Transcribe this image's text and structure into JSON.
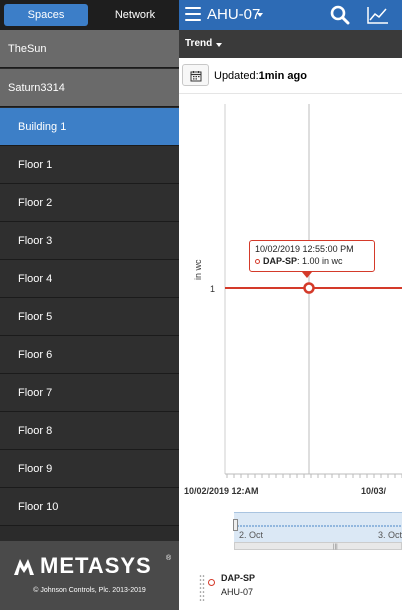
{
  "tabs": {
    "spaces": "Spaces",
    "network": "Network"
  },
  "nav": {
    "items": [
      "TheSun",
      "Saturn3314",
      "Building 1",
      "Floor 1",
      "Floor 2",
      "Floor 3",
      "Floor 4",
      "Floor 5",
      "Floor 6",
      "Floor 7",
      "Floor 8",
      "Floor 9",
      "Floor 10"
    ],
    "selected_index": 2
  },
  "brand": {
    "name": "METASYS",
    "trademark": "®",
    "copyright": "© Johnson Controls, Plc. 2013-2019"
  },
  "header": {
    "title": "AHU-07"
  },
  "subbar": {
    "view_label": "Trend"
  },
  "status": {
    "prefix": "Updated:",
    "value": "1min ago"
  },
  "chart_data": {
    "type": "line",
    "ylabel": "in wc",
    "y_ticks": [
      "1"
    ],
    "x_ticks": [
      "10/02/2019 12:AM",
      "10/03/"
    ],
    "series": [
      {
        "name": "DAP-SP",
        "source": "AHU-07",
        "color": "#d43a2a",
        "values": [
          1.0
        ]
      }
    ],
    "tooltip": {
      "timestamp": "10/02/2019 12:55:00 PM",
      "series": "DAP-SP",
      "value_text": "1.00 in wc"
    },
    "navigator": {
      "labels": [
        "2. Oct",
        "3. Oct"
      ]
    }
  },
  "legend": {
    "series": "DAP-SP",
    "source": "AHU-07"
  }
}
